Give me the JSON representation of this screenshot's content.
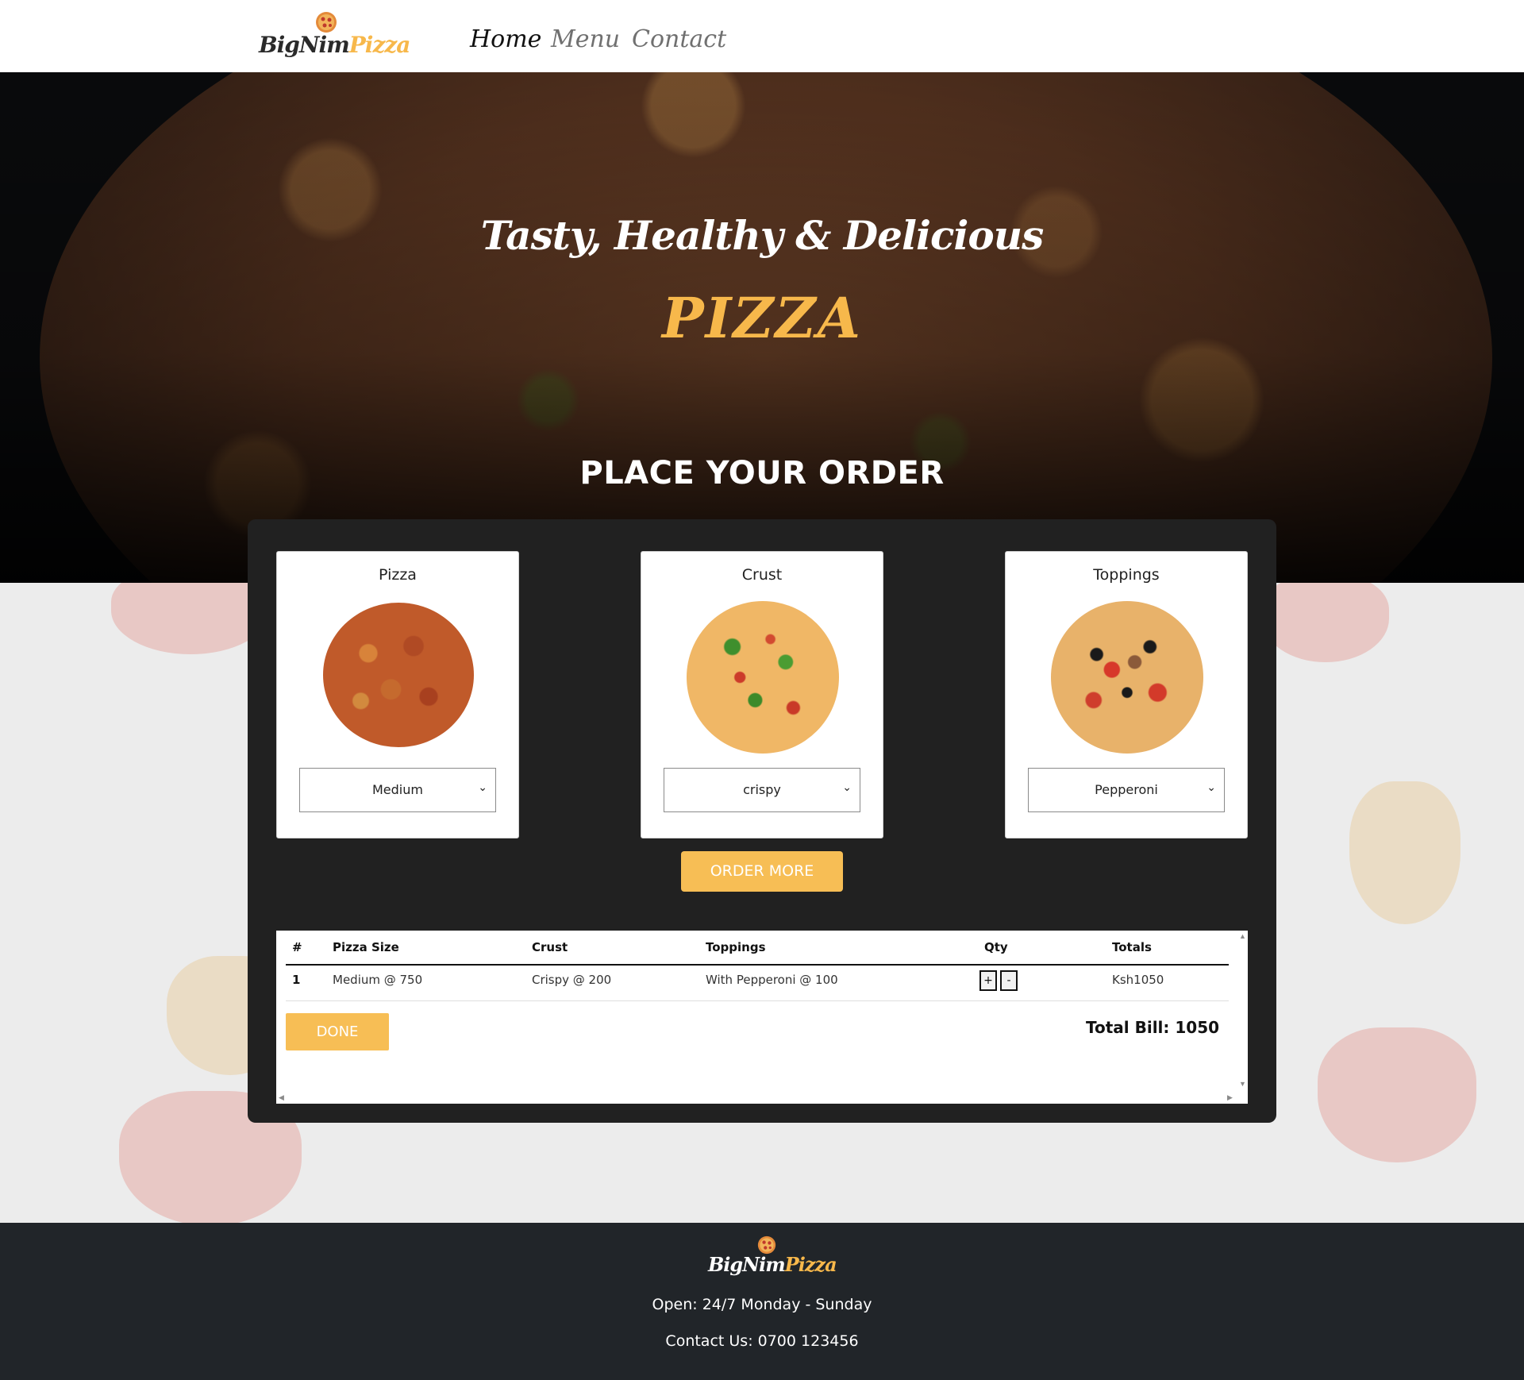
{
  "brand": {
    "part1": "BigNim",
    "part2": "Pizza",
    "mark_icon": "pizza-icon"
  },
  "nav": {
    "items": [
      {
        "label": "Home"
      },
      {
        "label": "Menu"
      },
      {
        "label": "Contact"
      }
    ]
  },
  "hero": {
    "tagline": "Tasty, Healthy & Delicious",
    "title": "PIZZA",
    "subtitle": "PLACE YOUR ORDER"
  },
  "order": {
    "cards": [
      {
        "title": "Pizza",
        "selected": "Medium"
      },
      {
        "title": "Crust",
        "selected": "crispy"
      },
      {
        "title": "Toppings",
        "selected": "Pepperoni"
      }
    ],
    "order_more_label": "ORDER MORE"
  },
  "table": {
    "headers": [
      "#",
      "Pizza Size",
      "Crust",
      "Toppings",
      "Qty",
      "Totals"
    ],
    "rows": [
      {
        "num": "1",
        "size": "Medium @ 750",
        "crust": "Crispy @ 200",
        "toppings": "With Pepperoni @ 100",
        "qty_plus": "+",
        "qty_minus": "-",
        "total": "Ksh1050"
      }
    ],
    "done_label": "DONE",
    "total_bill": "Total Bill: 1050"
  },
  "footer": {
    "brand_part1": "BigNim",
    "brand_part2": "Pizza",
    "hours": "Open: 24/7 Monday - Sunday",
    "contact": "Contact Us: 0700 123456"
  },
  "colors": {
    "accent": "#f7be55",
    "panel": "#212121",
    "footer": "#212529"
  }
}
